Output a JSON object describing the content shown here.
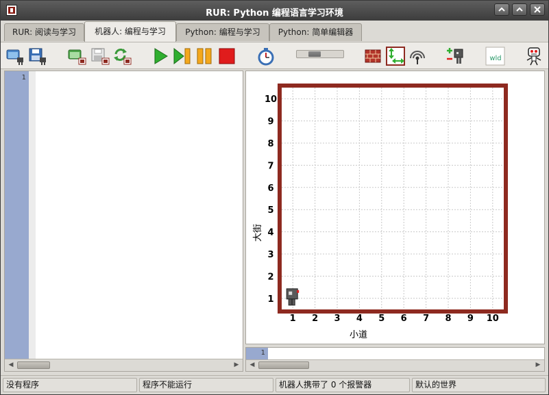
{
  "window": {
    "title": "RUR: Python 编程语言学习环境"
  },
  "tabs": [
    {
      "label": "RUR: 阅读与学习"
    },
    {
      "label": "机器人: 编程与学习"
    },
    {
      "label": "Python: 编程与学习"
    },
    {
      "label": "Python: 简单编辑器"
    }
  ],
  "toolbar": {
    "icons": [
      "open-program-icon",
      "save-program-icon",
      "open-world-icon",
      "save-world-icon",
      "reload-world-icon",
      "run-icon",
      "step-icon",
      "pause-icon",
      "stop-icon",
      "timer-icon",
      "speed-slider",
      "add-wall-icon",
      "resize-world-icon",
      "beeper-icon",
      "add-robot-icon",
      "world-file-icon",
      "robot-icon"
    ],
    "world_file_label": "wld",
    "speed_level": 0.33
  },
  "editor": {
    "line_number": "1"
  },
  "bottom_pane": {
    "line_number": "1"
  },
  "world": {
    "x_labels": [
      "1",
      "2",
      "3",
      "4",
      "5",
      "6",
      "7",
      "8",
      "9",
      "10"
    ],
    "y_labels": [
      "1",
      "2",
      "3",
      "4",
      "5",
      "6",
      "7",
      "8",
      "9",
      "10"
    ],
    "x_axis_label": "小道",
    "y_axis_label": "大街",
    "robot": {
      "x": 1,
      "y": 1
    }
  },
  "colors": {
    "wall": "#8e2a20",
    "gutter": "#98a9cf",
    "grid": "#c8c8c8"
  },
  "status": [
    "没有程序",
    "程序不能运行",
    "机器人携带了 0 个报警器",
    "默认的世界"
  ]
}
